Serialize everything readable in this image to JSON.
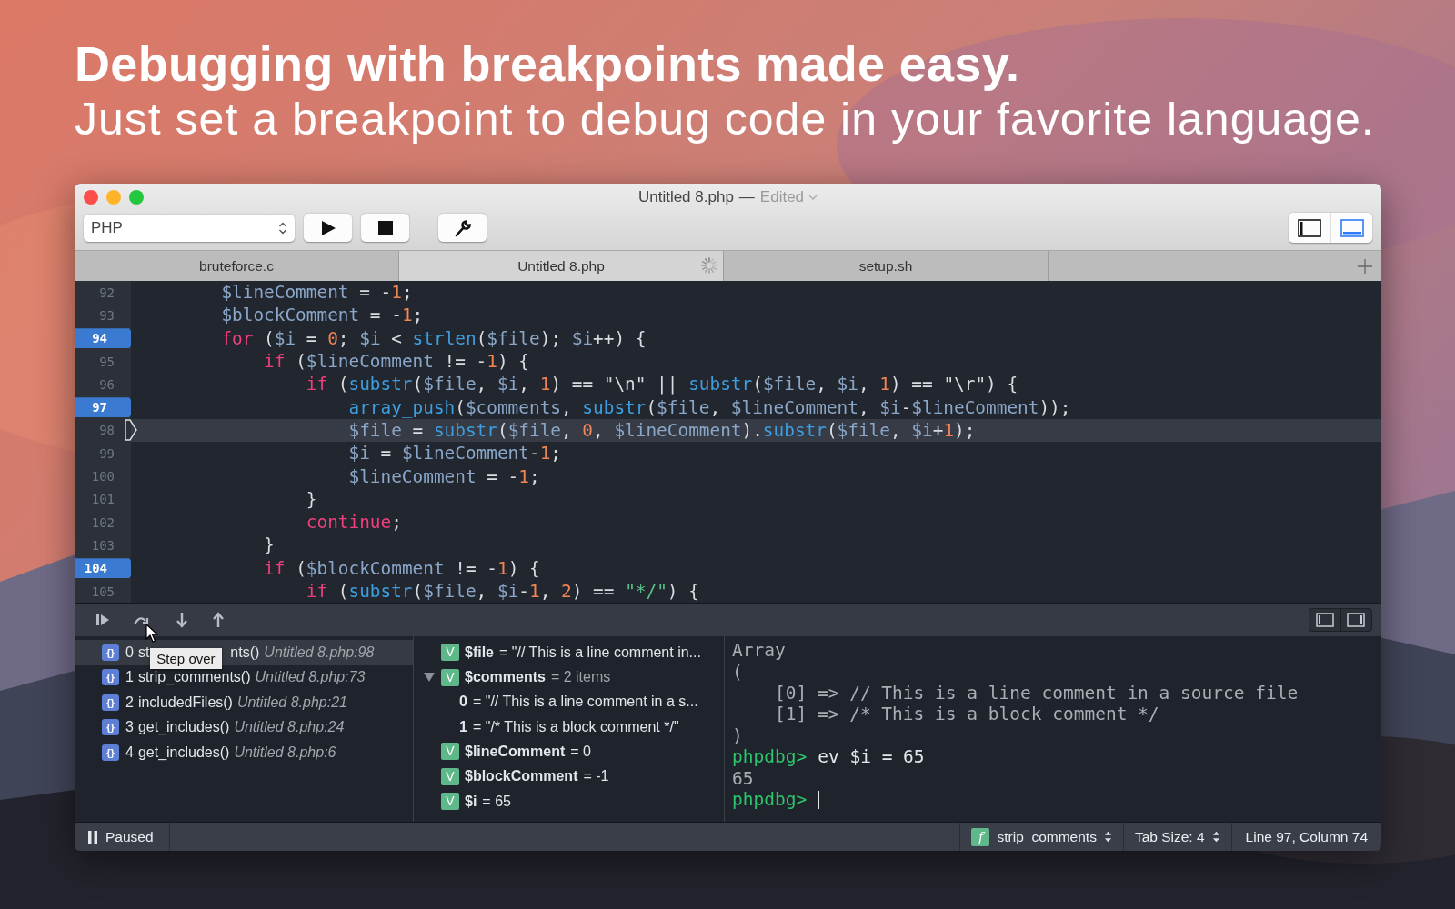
{
  "headline": {
    "title": "Debugging with breakpoints made easy.",
    "subtitle": "Just set a breakpoint to debug code in your favorite language."
  },
  "window": {
    "title": "Untitled 8.php",
    "separator": "—",
    "status": "Edited"
  },
  "toolbar": {
    "language": "PHP",
    "layout_toggles": [
      {
        "kind": "sidebar",
        "selected": false
      },
      {
        "kind": "bottom-panel",
        "selected": true
      }
    ]
  },
  "tabs": [
    {
      "label": "bruteforce.c",
      "selected": false,
      "loading": false
    },
    {
      "label": "Untitled 8.php",
      "selected": true,
      "loading": true
    },
    {
      "label": "setup.sh",
      "selected": false,
      "loading": false
    }
  ],
  "editor": {
    "lines": [
      {
        "number": "92",
        "breakpoint": false,
        "current": false,
        "tokens": [
          {
            "kind": "variable",
            "text": "        $lineComment"
          },
          {
            "kind": "plain",
            "text": " = -"
          },
          {
            "kind": "number",
            "text": "1"
          },
          {
            "kind": "plain",
            "text": ";"
          }
        ]
      },
      {
        "number": "93",
        "breakpoint": false,
        "current": false,
        "tokens": [
          {
            "kind": "variable",
            "text": "        $blockComment"
          },
          {
            "kind": "plain",
            "text": " = -"
          },
          {
            "kind": "number",
            "text": "1"
          },
          {
            "kind": "plain",
            "text": ";"
          }
        ]
      },
      {
        "number": "94",
        "breakpoint": true,
        "current": false,
        "tokens": [
          {
            "kind": "keyword",
            "text": "        for"
          },
          {
            "kind": "plain",
            "text": " ("
          },
          {
            "kind": "variable",
            "text": "$i"
          },
          {
            "kind": "plain",
            "text": " = "
          },
          {
            "kind": "number",
            "text": "0"
          },
          {
            "kind": "plain",
            "text": "; "
          },
          {
            "kind": "variable",
            "text": "$i"
          },
          {
            "kind": "plain",
            "text": " < "
          },
          {
            "kind": "function",
            "text": "strlen"
          },
          {
            "kind": "plain",
            "text": "("
          },
          {
            "kind": "variable",
            "text": "$file"
          },
          {
            "kind": "plain",
            "text": "); "
          },
          {
            "kind": "variable",
            "text": "$i"
          },
          {
            "kind": "plain",
            "text": "++) {"
          }
        ]
      },
      {
        "number": "95",
        "breakpoint": false,
        "current": false,
        "tokens": [
          {
            "kind": "keyword",
            "text": "            if"
          },
          {
            "kind": "plain",
            "text": " ("
          },
          {
            "kind": "variable",
            "text": "$lineComment"
          },
          {
            "kind": "plain",
            "text": " != -"
          },
          {
            "kind": "number",
            "text": "1"
          },
          {
            "kind": "plain",
            "text": ") {"
          }
        ]
      },
      {
        "number": "96",
        "breakpoint": false,
        "current": false,
        "tokens": [
          {
            "kind": "keyword",
            "text": "                if"
          },
          {
            "kind": "plain",
            "text": " ("
          },
          {
            "kind": "function",
            "text": "substr"
          },
          {
            "kind": "plain",
            "text": "("
          },
          {
            "kind": "variable",
            "text": "$file"
          },
          {
            "kind": "plain",
            "text": ", "
          },
          {
            "kind": "variable",
            "text": "$i"
          },
          {
            "kind": "plain",
            "text": ", "
          },
          {
            "kind": "number",
            "text": "1"
          },
          {
            "kind": "plain",
            "text": ") == \"\\n\" || "
          },
          {
            "kind": "function",
            "text": "substr"
          },
          {
            "kind": "plain",
            "text": "("
          },
          {
            "kind": "variable",
            "text": "$file"
          },
          {
            "kind": "plain",
            "text": ", "
          },
          {
            "kind": "variable",
            "text": "$i"
          },
          {
            "kind": "plain",
            "text": ", "
          },
          {
            "kind": "number",
            "text": "1"
          },
          {
            "kind": "plain",
            "text": ") == \"\\r\") {"
          }
        ]
      },
      {
        "number": "97",
        "breakpoint": true,
        "current": false,
        "tokens": [
          {
            "kind": "function",
            "text": "                    array_push"
          },
          {
            "kind": "plain",
            "text": "("
          },
          {
            "kind": "variable",
            "text": "$comments"
          },
          {
            "kind": "plain",
            "text": ", "
          },
          {
            "kind": "function",
            "text": "substr"
          },
          {
            "kind": "plain",
            "text": "("
          },
          {
            "kind": "variable",
            "text": "$file"
          },
          {
            "kind": "plain",
            "text": ", "
          },
          {
            "kind": "variable",
            "text": "$lineComment"
          },
          {
            "kind": "plain",
            "text": ", "
          },
          {
            "kind": "variable",
            "text": "$i"
          },
          {
            "kind": "plain",
            "text": "-"
          },
          {
            "kind": "variable",
            "text": "$lineComment"
          },
          {
            "kind": "plain",
            "text": "));"
          }
        ]
      },
      {
        "number": "98",
        "breakpoint": false,
        "current": true,
        "tokens": [
          {
            "kind": "variable",
            "text": "                    $file"
          },
          {
            "kind": "plain",
            "text": " = "
          },
          {
            "kind": "function",
            "text": "substr"
          },
          {
            "kind": "plain",
            "text": "("
          },
          {
            "kind": "variable",
            "text": "$file"
          },
          {
            "kind": "plain",
            "text": ", "
          },
          {
            "kind": "number",
            "text": "0"
          },
          {
            "kind": "plain",
            "text": ", "
          },
          {
            "kind": "variable",
            "text": "$lineComment"
          },
          {
            "kind": "plain",
            "text": ")."
          },
          {
            "kind": "function",
            "text": "substr"
          },
          {
            "kind": "plain",
            "text": "("
          },
          {
            "kind": "variable",
            "text": "$file"
          },
          {
            "kind": "plain",
            "text": ", "
          },
          {
            "kind": "variable",
            "text": "$i"
          },
          {
            "kind": "plain",
            "text": "+"
          },
          {
            "kind": "number",
            "text": "1"
          },
          {
            "kind": "plain",
            "text": ");"
          }
        ]
      },
      {
        "number": "99",
        "breakpoint": false,
        "current": false,
        "tokens": [
          {
            "kind": "variable",
            "text": "                    $i"
          },
          {
            "kind": "plain",
            "text": " = "
          },
          {
            "kind": "variable",
            "text": "$lineComment"
          },
          {
            "kind": "plain",
            "text": "-"
          },
          {
            "kind": "number",
            "text": "1"
          },
          {
            "kind": "plain",
            "text": ";"
          }
        ]
      },
      {
        "number": "100",
        "breakpoint": false,
        "current": false,
        "tokens": [
          {
            "kind": "variable",
            "text": "                    $lineComment"
          },
          {
            "kind": "plain",
            "text": " = -"
          },
          {
            "kind": "number",
            "text": "1"
          },
          {
            "kind": "plain",
            "text": ";"
          }
        ]
      },
      {
        "number": "101",
        "breakpoint": false,
        "current": false,
        "tokens": [
          {
            "kind": "plain",
            "text": "                }"
          }
        ]
      },
      {
        "number": "102",
        "breakpoint": false,
        "current": false,
        "tokens": [
          {
            "kind": "keyword",
            "text": "                continue"
          },
          {
            "kind": "plain",
            "text": ";"
          }
        ]
      },
      {
        "number": "103",
        "breakpoint": false,
        "current": false,
        "tokens": [
          {
            "kind": "plain",
            "text": "            }"
          }
        ]
      },
      {
        "number": "104",
        "breakpoint": true,
        "current": false,
        "tokens": [
          {
            "kind": "keyword",
            "text": "            if"
          },
          {
            "kind": "plain",
            "text": " ("
          },
          {
            "kind": "variable",
            "text": "$blockComment"
          },
          {
            "kind": "plain",
            "text": " != -"
          },
          {
            "kind": "number",
            "text": "1"
          },
          {
            "kind": "plain",
            "text": ") {"
          }
        ]
      },
      {
        "number": "105",
        "breakpoint": false,
        "current": false,
        "tokens": [
          {
            "kind": "keyword",
            "text": "                if"
          },
          {
            "kind": "plain",
            "text": " ("
          },
          {
            "kind": "function",
            "text": "substr"
          },
          {
            "kind": "plain",
            "text": "("
          },
          {
            "kind": "variable",
            "text": "$file"
          },
          {
            "kind": "plain",
            "text": ", "
          },
          {
            "kind": "variable",
            "text": "$i"
          },
          {
            "kind": "plain",
            "text": "-"
          },
          {
            "kind": "number",
            "text": "1"
          },
          {
            "kind": "plain",
            "text": ", "
          },
          {
            "kind": "number",
            "text": "2"
          },
          {
            "kind": "plain",
            "text": ") == "
          },
          {
            "kind": "string",
            "text": "\"*/\""
          },
          {
            "kind": "plain",
            "text": ") {"
          }
        ]
      }
    ]
  },
  "debugger": {
    "buttons": [
      {
        "kind": "continue"
      },
      {
        "kind": "step-over"
      },
      {
        "kind": "step-into"
      },
      {
        "kind": "step-out"
      }
    ],
    "tooltip": "Step over",
    "pane_toggles": [
      {
        "kind": "left-pane"
      },
      {
        "kind": "right-pane"
      }
    ],
    "stack": [
      {
        "badge": "{}",
        "index": "0",
        "func": "st",
        "func_after_tooltip": "nts()",
        "location": "Untitled 8.php:98",
        "selected": true
      },
      {
        "badge": "{}",
        "index": "1",
        "func": "strip_comments()",
        "location": "Untitled 8.php:73",
        "selected": false
      },
      {
        "badge": "{}",
        "index": "2",
        "func": "includedFiles()",
        "location": "Untitled 8.php:21",
        "selected": false
      },
      {
        "badge": "{}",
        "index": "3",
        "func": "get_includes()",
        "location": "Untitled 8.php:24",
        "selected": false
      },
      {
        "badge": "{}",
        "index": "4",
        "func": "get_includes()",
        "location": "Untitled 8.php:6",
        "selected": false
      }
    ],
    "variables": [
      {
        "kind": "variable",
        "badge": "V",
        "name": "$file",
        "value": "= \"// This is a line comment in...",
        "dim": false
      },
      {
        "kind": "variable",
        "badge": "V",
        "name": "$comments",
        "value": "= 2 items",
        "dim": true,
        "expanded": true,
        "children": [
          {
            "kind": "element",
            "name": "0",
            "value": "= \"// This is a line comment in a s...",
            "dim": false
          },
          {
            "kind": "element",
            "name": "1",
            "value": "= \"/* This is a block comment */\"",
            "dim": false
          }
        ]
      },
      {
        "kind": "variable",
        "badge": "V",
        "name": "$lineComment",
        "value": "= 0",
        "dim": false
      },
      {
        "kind": "variable",
        "badge": "V",
        "name": "$blockComment",
        "value": "= -1",
        "dim": false
      },
      {
        "kind": "variable",
        "badge": "V",
        "name": "$i",
        "value": "= 65",
        "dim": false
      }
    ],
    "console": [
      {
        "kind": "output",
        "text": "Array"
      },
      {
        "kind": "output",
        "text": "("
      },
      {
        "kind": "output",
        "text": "    [0] => // This is a line comment in a source file"
      },
      {
        "kind": "output",
        "text": "    [1] => /* This is a block comment */"
      },
      {
        "kind": "output",
        "text": ")"
      },
      {
        "kind": "prompt",
        "prompt": "phpdbg>",
        "command": "ev $i = 65",
        "cursor": false
      },
      {
        "kind": "output",
        "text": "65"
      },
      {
        "kind": "prompt",
        "prompt": "phpdbg>",
        "cursor": true
      }
    ]
  },
  "status_bar": {
    "paused": true,
    "state_label": "Paused",
    "function": {
      "badge": "f",
      "label": "strip_comments"
    },
    "tab_size": "Tab Size: 4",
    "position": "Line 97, Column 74"
  }
}
